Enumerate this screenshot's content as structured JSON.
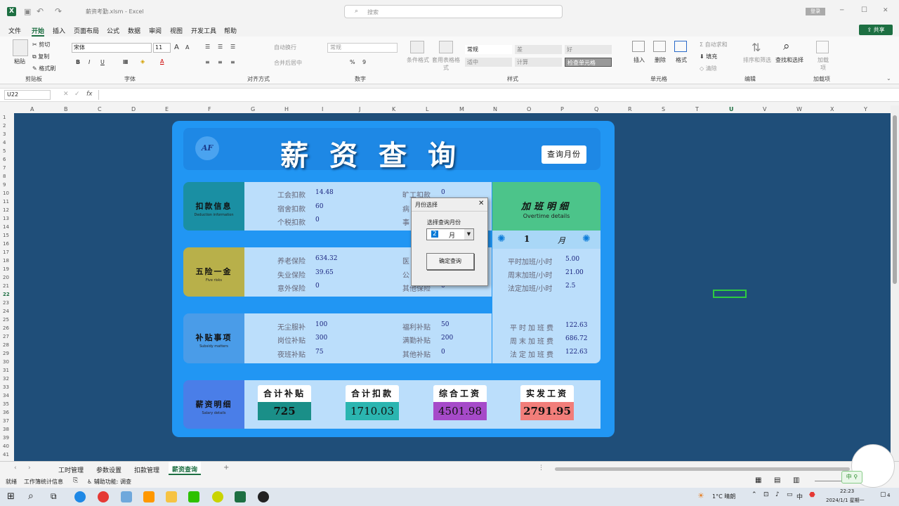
{
  "titlebar": {
    "app_icon": "X",
    "filename": "薪资考勤.xlsm",
    "separator": "-",
    "app_name": "Excel",
    "search_placeholder": "搜索",
    "signin": "登录",
    "min": "─",
    "max": "☐",
    "close": "✕"
  },
  "menu": {
    "items": [
      "文件",
      "开始",
      "插入",
      "页面布局",
      "公式",
      "数据",
      "审阅",
      "视图",
      "开发工具",
      "帮助"
    ],
    "active_index": 1,
    "share": "共享"
  },
  "ribbon": {
    "clipboard": {
      "paste": "粘贴",
      "cut": "剪切",
      "copy": "复制",
      "format_painter": "格式刷",
      "group": "剪贴板"
    },
    "font": {
      "name": "宋体",
      "size": "11",
      "bold": "B",
      "italic": "I",
      "underline": "U",
      "grow": "A",
      "shrink": "A",
      "group": "字体"
    },
    "align": {
      "wrap": "自动换行",
      "merge": "合并后居中",
      "group": "对齐方式"
    },
    "number": {
      "format": "常规",
      "percent": "%",
      "comma": "9",
      "group": "数字"
    },
    "styles": {
      "cond": "条件格式",
      "table": "套用表格格式",
      "cells": [
        "常规",
        "差",
        "好",
        "适中",
        "计算",
        "检查单元格"
      ],
      "group": "样式"
    },
    "cells": {
      "insert": "插入",
      "delete": "删除",
      "format": "格式",
      "group": "单元格"
    },
    "editing": {
      "autosum": "自动求和",
      "fill": "填充",
      "clear": "清除",
      "sort": "排序和筛选",
      "find": "查找和选择",
      "group": "编辑"
    },
    "addins": {
      "addin": "加载项",
      "group": "加载项"
    }
  },
  "formula_bar": {
    "namebox": "U22",
    "fx": "fx",
    "cancel": "✕",
    "enter": "✓",
    "value": ""
  },
  "columns": [
    "A",
    "B",
    "C",
    "D",
    "E",
    "F",
    "G",
    "H",
    "I",
    "J",
    "K",
    "L",
    "M",
    "N",
    "O",
    "P",
    "Q",
    "R",
    "S",
    "T",
    "U",
    "V",
    "W",
    "X",
    "Y"
  ],
  "rows": [
    "1",
    "2",
    "3",
    "4",
    "5",
    "6",
    "7",
    "8",
    "9",
    "10",
    "11",
    "12",
    "13",
    "14",
    "15",
    "16",
    "17",
    "18",
    "19",
    "20",
    "21",
    "22",
    "23",
    "24",
    "25",
    "26",
    "27",
    "28",
    "29",
    "30",
    "31",
    "32",
    "33",
    "34",
    "35",
    "36",
    "37",
    "38",
    "39",
    "40",
    "41"
  ],
  "dashboard": {
    "logo": "AF",
    "title": "薪资查询",
    "query_button": "查询月份",
    "deductions": {
      "name": "扣款信息",
      "sub": "Deduction information",
      "items": [
        {
          "l": "工会扣款",
          "v": "14.48"
        },
        {
          "l": "宿舍扣款",
          "v": "60"
        },
        {
          "l": "个税扣款",
          "v": "0"
        },
        {
          "l": "旷工扣款",
          "v": "0"
        },
        {
          "l": "病",
          "v": ""
        },
        {
          "l": "事",
          "v": ""
        }
      ]
    },
    "overtime": {
      "title": "加班明细",
      "sub": "Overtime details",
      "month_prefix": "1",
      "month_suffix": "月",
      "items": [
        {
          "l": "平时加班/小时",
          "v": "5.00"
        },
        {
          "l": "周末加班/小时",
          "v": "21.00"
        },
        {
          "l": "法定加班/小时",
          "v": "2.5"
        }
      ],
      "fees": [
        {
          "l": "平时加班费",
          "v": "122.63"
        },
        {
          "l": "周末加班费",
          "v": "686.72"
        },
        {
          "l": "法定加班费",
          "v": "122.63"
        }
      ]
    },
    "insurance": {
      "name": "五险一金",
      "sub": "Five risks",
      "items": [
        {
          "l": "养老保险",
          "v": "634.32"
        },
        {
          "l": "失业保险",
          "v": "39.65"
        },
        {
          "l": "意外保险",
          "v": "0"
        },
        {
          "l": "医",
          "v": ""
        },
        {
          "l": "公",
          "v": ""
        },
        {
          "l": "其他保险",
          "v": "0"
        }
      ]
    },
    "subsidy": {
      "name": "补贴事项",
      "sub": "Subsidy matters",
      "items": [
        {
          "l": "无尘服补",
          "v": "100"
        },
        {
          "l": "岗位补贴",
          "v": "300"
        },
        {
          "l": "夜班补贴",
          "v": "75"
        },
        {
          "l": "福利补贴",
          "v": "50"
        },
        {
          "l": "满勤补贴",
          "v": "200"
        },
        {
          "l": "其他补贴",
          "v": "0"
        }
      ]
    },
    "salary": {
      "name": "薪资明细",
      "sub": "Salary details",
      "totals": [
        {
          "h": "合计补贴",
          "v": "725",
          "c": "#1a8f88"
        },
        {
          "h": "合计扣款",
          "v": "1710.03",
          "c": "#2bb5b0"
        },
        {
          "h": "综合工资",
          "v": "4501.98",
          "c": "#a64ac9"
        },
        {
          "h": "实发工资",
          "v": "2791.95",
          "c": "#f27e7a"
        }
      ]
    }
  },
  "dialog": {
    "title": "月份选择",
    "close": "✕",
    "label": "选择查询月份",
    "month_value": "2",
    "month_unit": "月",
    "confirm": "确定查询"
  },
  "sheets": {
    "tabs": [
      "工时管理",
      "参数设置",
      "扣款管理",
      "薪资查询"
    ],
    "active": 3,
    "add": "+"
  },
  "status": {
    "ready": "就绪",
    "workbook": "工作簿统计信息",
    "accessibility": "辅助功能: 调查"
  },
  "taskbar": {
    "weather": "1°C 晴朗",
    "ime": "中",
    "time": "22:23",
    "date": "2024/1/1 星期一",
    "notif": "4"
  },
  "colors": {
    "excel_green": "#1d6f42",
    "grid_bg": "#1f4e79",
    "dash_blue": "#2196f3"
  }
}
